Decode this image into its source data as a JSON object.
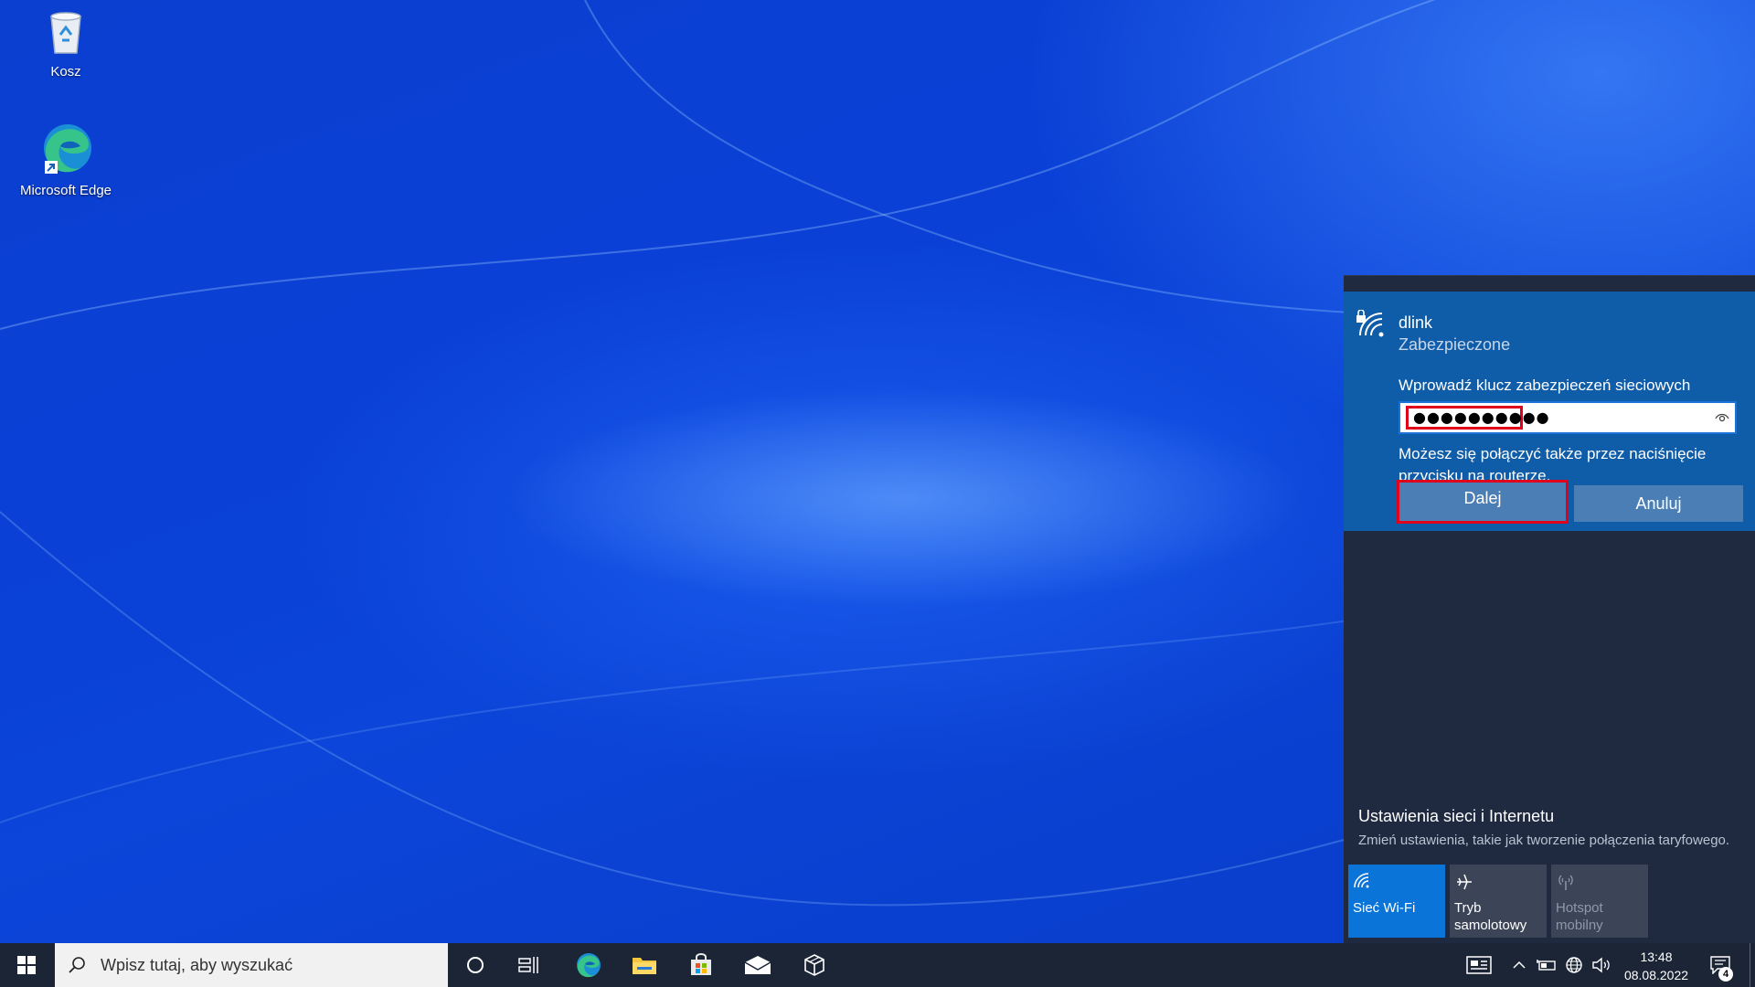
{
  "desktop": {
    "icons": [
      {
        "label": "Kosz",
        "icon": "recycle-bin-icon"
      },
      {
        "label": "Microsoft Edge",
        "icon": "edge-icon"
      }
    ]
  },
  "network_flyout": {
    "ssid": "dlink",
    "security_status": "Zabezpieczone",
    "key_label": "Wprowadź klucz zabezpieczeń sieciowych",
    "password_masked": "●●●●●●●●●●",
    "wps_hint": "Możesz się połączyć także przez naciśnięcie przycisku na routerze.",
    "next_label": "Dalej",
    "cancel_label": "Anuluj",
    "settings_title": "Ustawienia sieci i Internetu",
    "settings_subtitle": "Zmień ustawienia, takie jak tworzenie połączenia taryfowego.",
    "quick_actions": [
      {
        "label": "Sieć Wi-Fi",
        "state": "on"
      },
      {
        "label": "Tryb samolotowy",
        "state": "off"
      },
      {
        "label": "Hotspot mobilny",
        "state": "disabled"
      }
    ]
  },
  "taskbar": {
    "search_placeholder": "Wpisz tutaj, aby wyszukać",
    "clock_time": "13:48",
    "clock_date": "08.08.2022",
    "notification_count": "4"
  },
  "colors": {
    "flyout_card": "#0f5ca8",
    "flyout_bg": "#1f2a40",
    "highlight": "#e0001b",
    "wifi_tile": "#0b74d8"
  }
}
